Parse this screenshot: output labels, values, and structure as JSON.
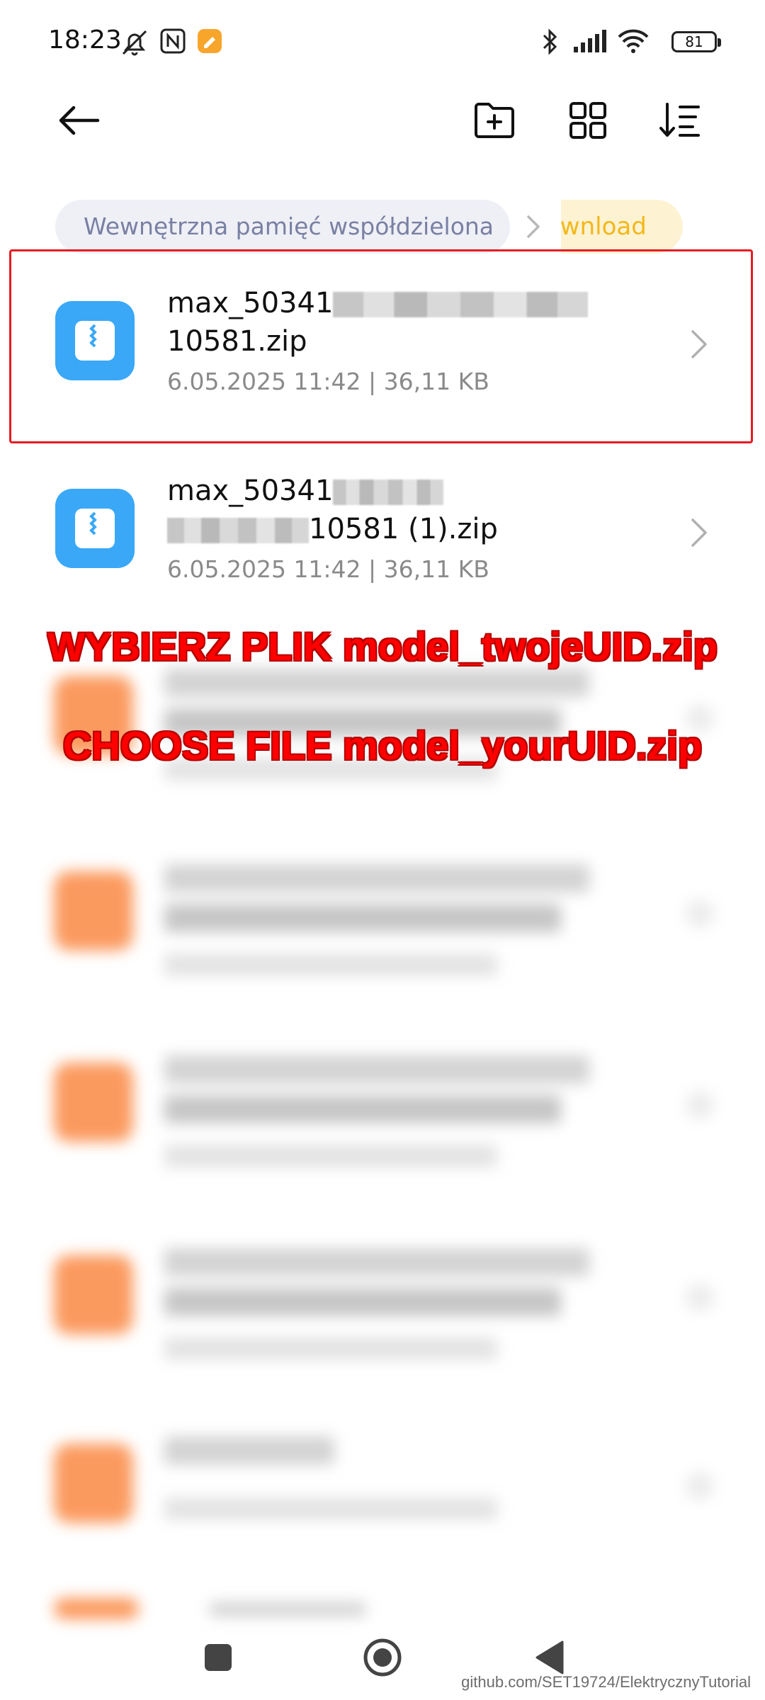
{
  "status_bar": {
    "time": "18:23",
    "battery": "81",
    "icons": [
      "silent-bell-icon",
      "nfc-icon",
      "app-notification-icon",
      "bluetooth-icon",
      "signal-icon",
      "wifi-icon",
      "battery-icon"
    ]
  },
  "toolbar": {
    "icons": [
      "back-arrow-icon",
      "new-folder-icon",
      "grid-view-icon",
      "sort-icon"
    ]
  },
  "breadcrumb": {
    "parent": "Wewnętrzna pamięć współdzielona",
    "current": "ownload"
  },
  "files": [
    {
      "name_line1": "max_50341",
      "name_line2_prefix": "",
      "name_line2": "10581.zip",
      "meta": "6.05.2025 11:42  |  36,11 KB"
    },
    {
      "name_line1": "max_50341",
      "name_line2_prefix": "",
      "name_line2": "10581 (1).zip",
      "meta": "6.05.2025 11:42  |  36,11 KB"
    }
  ],
  "overlay": {
    "line_pl": "WYBIERZ PLIK model_twojeUID.zip",
    "line_en": "CHOOSE FILE model_yourUID.zip"
  },
  "nav": {
    "icons": [
      "recents-square-icon",
      "home-circle-icon",
      "back-triangle-icon"
    ]
  },
  "watermark": "github.com/SET19724/ElektrycznyTutorial",
  "colors": {
    "zip_icon": "#3aa8f6",
    "highlight_border": "#e51c23",
    "overlay_text": "#ff0000",
    "breadcrumb_current": "#f3b71a"
  }
}
